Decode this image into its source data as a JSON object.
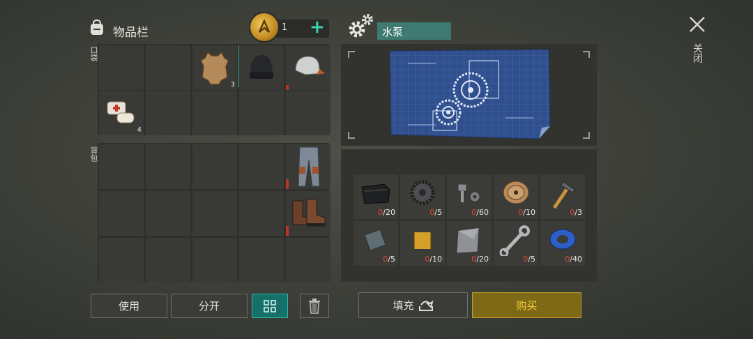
{
  "inventory": {
    "title": "物品栏",
    "pocket_label": "口袋",
    "backpack_label": "背包",
    "items": {
      "leather": {
        "icon": "leather-hide-icon",
        "count": "3"
      },
      "beanie": {
        "icon": "beanie-hat-icon"
      },
      "cap": {
        "icon": "baseball-cap-icon"
      },
      "bandage": {
        "icon": "bandage-icon",
        "count": "4"
      },
      "pants": {
        "icon": "pants-icon"
      },
      "boots": {
        "icon": "boots-icon"
      }
    },
    "colors": {
      "durability": "#b8372b",
      "selected_marker": "#3aa395"
    }
  },
  "currency": {
    "icon": "gold-coin-icon",
    "count": "1",
    "add_label": "+"
  },
  "craft": {
    "title": "水泵",
    "materials": [
      {
        "name": "rubber-sheet-icon",
        "have": "0",
        "need": "/20"
      },
      {
        "name": "gear-part-icon",
        "have": "0",
        "need": "/5"
      },
      {
        "name": "bolt-nut-icon",
        "have": "0",
        "need": "/60"
      },
      {
        "name": "wire-spool-icon",
        "have": "0",
        "need": "/10"
      },
      {
        "name": "hammer-icon",
        "have": "0",
        "need": "/3"
      },
      {
        "name": "metal-plate-icon",
        "have": "0",
        "need": "/5"
      },
      {
        "name": "oil-filter-icon",
        "have": "0",
        "need": "/10"
      },
      {
        "name": "steel-sheet-icon",
        "have": "0",
        "need": "/20"
      },
      {
        "name": "wrench-icon",
        "have": "0",
        "need": "/5"
      },
      {
        "name": "duct-tape-icon",
        "have": "0",
        "need": "/40"
      }
    ]
  },
  "buttons": {
    "use": "使用",
    "split": "分开",
    "fill": "填充",
    "buy": "购买"
  },
  "close_label": "关闭",
  "accent_colors": {
    "teal": "#16706a",
    "gold": "#c29f26",
    "missing": "#d9473a"
  }
}
